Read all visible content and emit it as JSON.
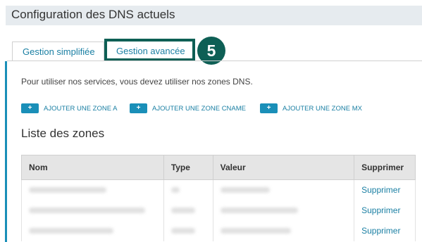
{
  "header": {
    "title": "Configuration des DNS actuels"
  },
  "tabs": [
    {
      "label": "Gestion simplifiée"
    },
    {
      "label": "Gestion avancée"
    }
  ],
  "step_badge": "5",
  "intro_text": "Pour utiliser nos services, vous devez utiliser nos zones DNS.",
  "buttons": {
    "plus": "+",
    "add_a": "AJOUTER UNE ZONE A",
    "add_cname": "AJOUTER UNE ZONE CNAME",
    "add_mx": "AJOUTER UNE ZONE MX"
  },
  "section_title": "Liste des zones",
  "table": {
    "columns": [
      "Nom",
      "Type",
      "Valeur",
      "Supprimer"
    ],
    "rows": [
      {
        "delete_label": "Supprimer"
      },
      {
        "delete_label": "Supprimer"
      },
      {
        "delete_label": "Supprimer"
      }
    ]
  },
  "colors": {
    "accent": "#1a8fb8",
    "highlight": "#0e5f55",
    "header_bg": "#e6ebef"
  }
}
